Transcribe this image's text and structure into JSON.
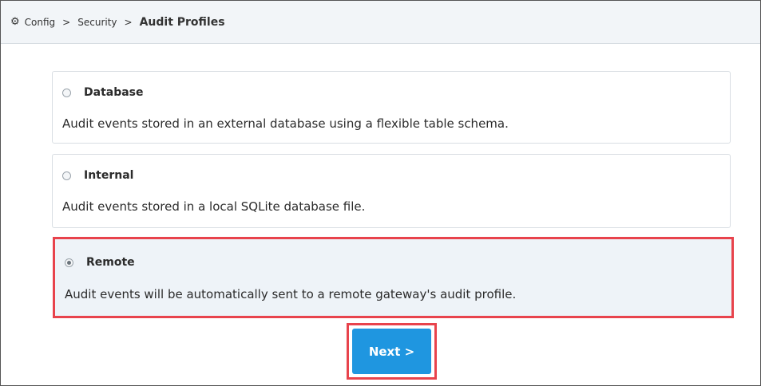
{
  "breadcrumb": {
    "icon": "gear-icon",
    "items": [
      "Config",
      "Security"
    ],
    "separator": ">",
    "current": "Audit Profiles"
  },
  "options": [
    {
      "title": "Database",
      "description": "Audit events stored in an external database using a flexible table schema.",
      "selected": false
    },
    {
      "title": "Internal",
      "description": "Audit events stored in a local SQLite database file.",
      "selected": false
    },
    {
      "title": "Remote",
      "description": "Audit events will be automatically sent to a remote gateway's audit profile.",
      "selected": true
    }
  ],
  "actions": {
    "next_label": "Next >"
  },
  "colors": {
    "accent": "#1f96e0",
    "highlight": "#e8434c",
    "selected_bg": "#eef3f8"
  }
}
